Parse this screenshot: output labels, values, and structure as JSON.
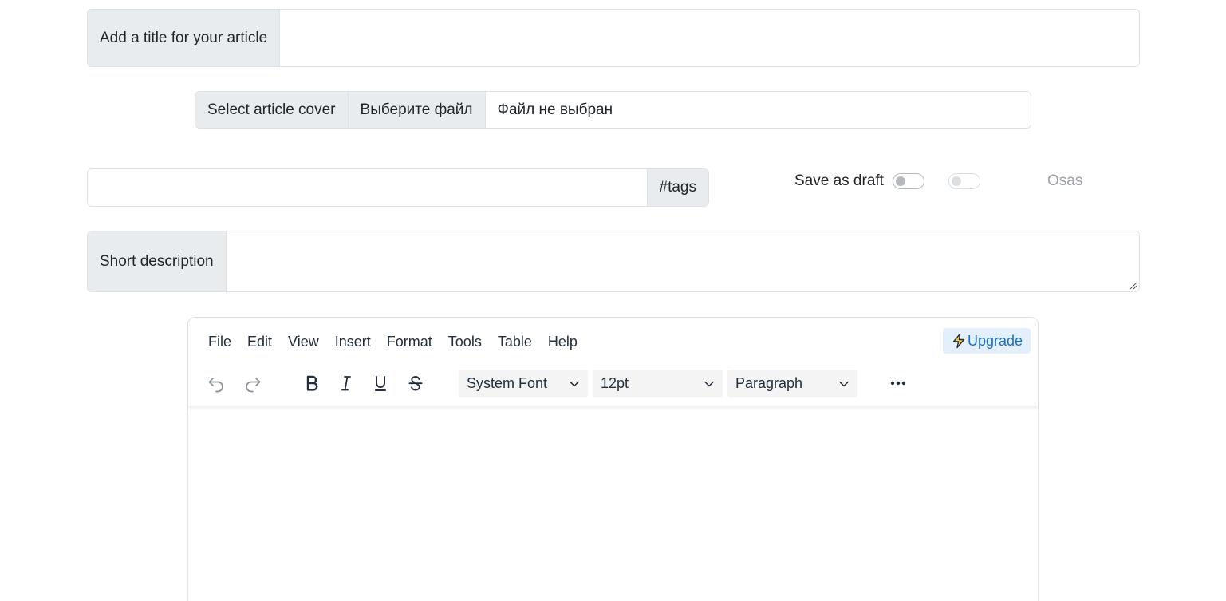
{
  "title_field": {
    "label": "Add a title for your article",
    "value": ""
  },
  "cover": {
    "label": "Select article cover",
    "choose_button": "Выберите файл",
    "status": "Файл не выбран"
  },
  "tags": {
    "value": "",
    "addon": "#tags"
  },
  "draft": {
    "label": "Save as draft",
    "checked": false
  },
  "secondary_toggle": {
    "checked": false,
    "disabled": true
  },
  "osas_label": "Osas",
  "description": {
    "label": "Short description",
    "value": ""
  },
  "editor": {
    "menu": [
      "File",
      "Edit",
      "View",
      "Insert",
      "Format",
      "Tools",
      "Table",
      "Help"
    ],
    "upgrade_label": "Upgrade",
    "font_family": "System Font",
    "font_size": "12pt",
    "block_format": "Paragraph",
    "icons": [
      "undo-icon",
      "redo-icon",
      "bold-icon",
      "italic-icon",
      "underline-icon",
      "strikethrough-icon",
      "more-icon"
    ],
    "accent_color": "#1a6fcc"
  }
}
